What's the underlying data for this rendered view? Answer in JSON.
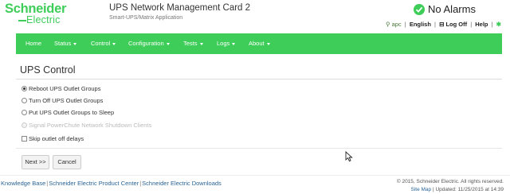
{
  "header": {
    "logo_line1": "Schneider",
    "logo_line2": "Electric",
    "product_name": "UPS Network Management Card 2",
    "product_sub": "Smart-UPS/Matrix Application",
    "alarm_status": "No Alarms",
    "toplinks": {
      "apc": "apc",
      "language": "English",
      "logoff": "Log Off",
      "help": "Help"
    }
  },
  "nav": {
    "items": [
      {
        "label": "Home",
        "dropdown": false
      },
      {
        "label": "Status",
        "dropdown": true
      },
      {
        "label": "Control",
        "dropdown": true
      },
      {
        "label": "Configuration",
        "dropdown": true
      },
      {
        "label": "Tests",
        "dropdown": true
      },
      {
        "label": "Logs",
        "dropdown": true
      },
      {
        "label": "About",
        "dropdown": true
      }
    ]
  },
  "main": {
    "title": "UPS Control",
    "options": [
      {
        "label": "Reboot UPS Outlet Groups",
        "type": "radio",
        "selected": true,
        "disabled": false
      },
      {
        "label": "Turn Off UPS Outlet Groups",
        "type": "radio",
        "selected": false,
        "disabled": false
      },
      {
        "label": "Put UPS Outlet Groups to Sleep",
        "type": "radio",
        "selected": false,
        "disabled": false
      },
      {
        "label": "Signal PowerChute Network Shutdown Clients",
        "type": "radio",
        "selected": false,
        "disabled": true
      },
      {
        "label": "Skip outlet off delays",
        "type": "checkbox",
        "selected": false,
        "disabled": false
      }
    ],
    "next_label": "Next >>",
    "cancel_label": "Cancel"
  },
  "footer": {
    "links": [
      "Knowledge Base",
      "Schneider Electric Product Center",
      "Schneider Electric Downloads"
    ],
    "copyright": "© 2015, Schneider Electric. All rights reserved.",
    "site_map": "Site Map",
    "updated": "Updated: 11/25/2015 at 14:39"
  },
  "colors": {
    "brand_green": "#3dcd58",
    "link_blue": "#2a6496"
  }
}
